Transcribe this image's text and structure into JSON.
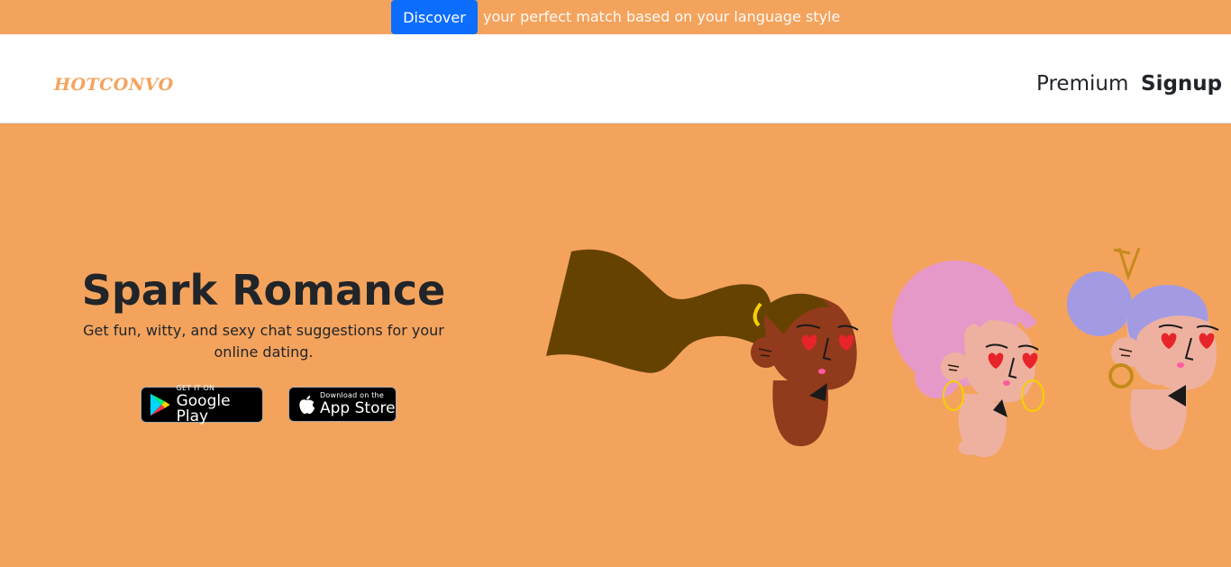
{
  "topbar": {
    "button_label": "Discover",
    "text": "your perfect match based on your language style"
  },
  "navbar": {
    "logo": "HOTCONVO",
    "links": [
      {
        "label": "Premium"
      },
      {
        "label": "Signup"
      }
    ]
  },
  "hero": {
    "title": "Spark Romance",
    "subtitle": "Get fun, witty, and sexy chat suggestions for your online dating.",
    "google_play": {
      "small": "GET IT ON",
      "big": "Google Play"
    },
    "app_store": {
      "small": "Download on the",
      "big": "App Store"
    }
  },
  "colors": {
    "brand_orange": "#f4a35d",
    "discover_blue": "#0d6efd",
    "text_dark": "#212529"
  },
  "icons": [
    "google-play-icon",
    "apple-icon"
  ]
}
